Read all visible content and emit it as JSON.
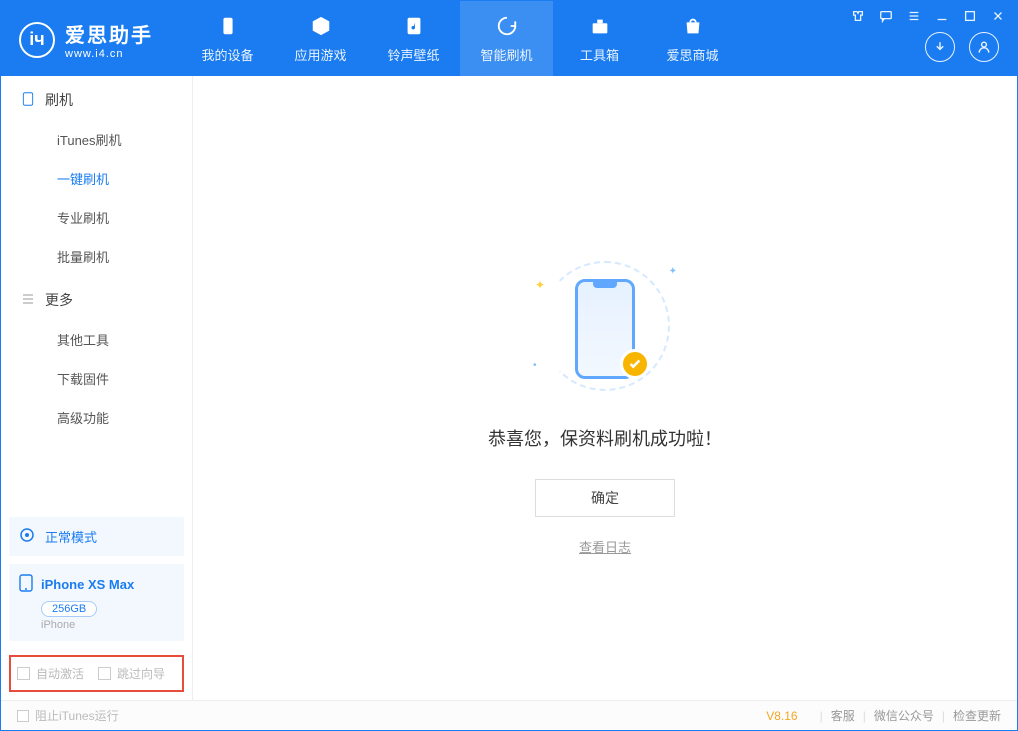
{
  "app": {
    "name": "爱思助手",
    "url": "www.i4.cn"
  },
  "nav": {
    "tabs": [
      {
        "label": "我的设备"
      },
      {
        "label": "应用游戏"
      },
      {
        "label": "铃声壁纸"
      },
      {
        "label": "智能刷机"
      },
      {
        "label": "工具箱"
      },
      {
        "label": "爱思商城"
      }
    ]
  },
  "sidebar": {
    "group1_title": "刷机",
    "group1_items": [
      {
        "label": "iTunes刷机"
      },
      {
        "label": "一键刷机"
      },
      {
        "label": "专业刷机"
      },
      {
        "label": "批量刷机"
      }
    ],
    "group2_title": "更多",
    "group2_items": [
      {
        "label": "其他工具"
      },
      {
        "label": "下载固件"
      },
      {
        "label": "高级功能"
      }
    ],
    "mode_label": "正常模式",
    "device": {
      "name": "iPhone XS Max",
      "capacity": "256GB",
      "type": "iPhone"
    },
    "options": {
      "auto_activate": "自动激活",
      "skip_guide": "跳过向导"
    }
  },
  "main": {
    "success_text": "恭喜您，保资料刷机成功啦！",
    "ok_button": "确定",
    "view_log": "查看日志"
  },
  "footer": {
    "block_itunes": "阻止iTunes运行",
    "version": "V8.16",
    "links": [
      "客服",
      "微信公众号",
      "检查更新"
    ]
  }
}
